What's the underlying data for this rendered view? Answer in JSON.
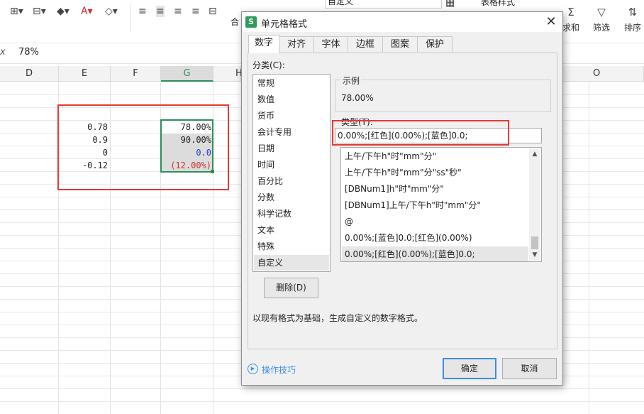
{
  "ribbon": {
    "merge_label": "合",
    "number_format_value": "自定义",
    "table_style_label": "表格样式",
    "sum_label": "求和",
    "filter_label": "筛选",
    "sort_label": "排序"
  },
  "formula_bar": {
    "fx": "x",
    "value": "78%"
  },
  "grid": {
    "columns": [
      "D",
      "E",
      "F",
      "G",
      "H",
      "O"
    ],
    "selected_column": "G",
    "col_e_values": [
      "0.78",
      "0.9",
      "0",
      "-0.12"
    ],
    "col_g_values": [
      "78.00%",
      "90.00%",
      "0.0",
      "(12.00%)"
    ],
    "colors": {
      "positive": "#222222",
      "zero_blue": "#1f3fd0",
      "negative_red": "#d32f2f"
    }
  },
  "dialog": {
    "title": "单元格格式",
    "close": "✕",
    "tabs": [
      "数字",
      "对齐",
      "字体",
      "边框",
      "图案",
      "保护"
    ],
    "active_tab": "数字",
    "category_label": "分类(C):",
    "categories": [
      "常规",
      "数值",
      "货币",
      "会计专用",
      "日期",
      "时间",
      "百分比",
      "分数",
      "科学记数",
      "文本",
      "特殊",
      "自定义"
    ],
    "selected_category": "自定义",
    "sample_label": "示例",
    "sample_value": "78.00%",
    "type_label": "类型(T):",
    "type_value": "0.00%;[红色](0.00%);[蓝色]0.0;",
    "format_list": [
      "上午/下午h\"时\"mm\"分\"",
      "上午/下午h\"时\"mm\"分\"ss\"秒\"",
      "[DBNum1]h\"时\"mm\"分\"",
      "[DBNum1]上午/下午h\"时\"mm\"分\"",
      "@",
      "0.00%;[蓝色]0.0;[红色](0.00%)",
      "0.00%;[红色](0.00%);[蓝色]0.0;"
    ],
    "delete_label": "删除(D)",
    "description": "以现有格式为基础，生成自定义的数字格式。",
    "tips_label": "操作技巧",
    "ok_label": "确定",
    "cancel_label": "取消"
  }
}
